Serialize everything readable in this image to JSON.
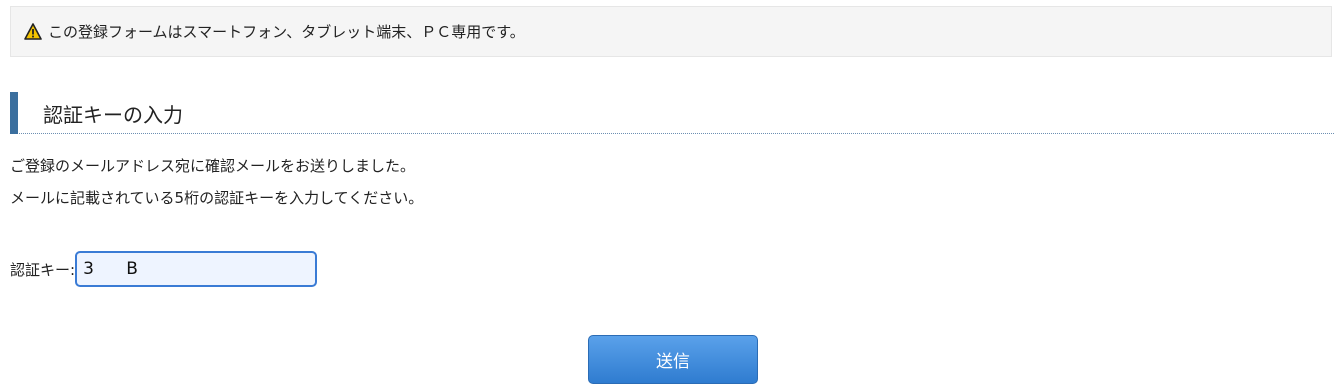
{
  "notice": {
    "icon": "warning-icon",
    "text": "この登録フォームはスマートフォン、タブレット端末、ＰＣ専用です。"
  },
  "section": {
    "title": "認証キーの入力",
    "accent_color": "#3b6f9e"
  },
  "description": {
    "line1": "ご登録のメールアドレス宛に確認メールをお送りしました。",
    "line2": "メールに記載されている5桁の認証キーを入力してください。"
  },
  "auth_key": {
    "label": "認証キー:",
    "value": "3      B"
  },
  "submit": {
    "label": "送信",
    "color": "#2f7cd0"
  }
}
